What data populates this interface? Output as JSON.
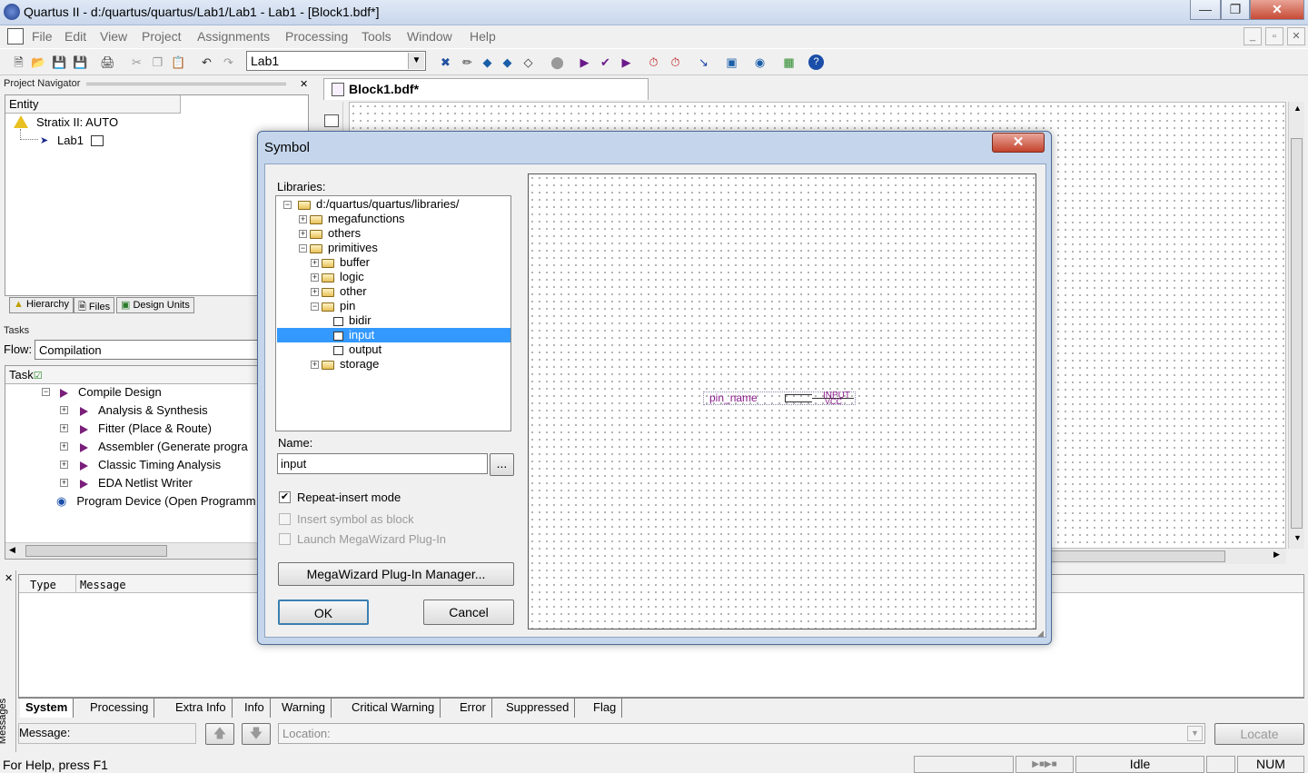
{
  "window": {
    "title": "Quartus II - d:/quartus/quartus/Lab1/Lab1 - Lab1 - [Block1.bdf*]"
  },
  "menu": [
    "File",
    "Edit",
    "View",
    "Project",
    "Assignments",
    "Processing",
    "Tools",
    "Window",
    "Help"
  ],
  "toolbar": {
    "project_value": "Lab1"
  },
  "project_navigator": {
    "title": "Project Navigator",
    "entity_header": "Entity",
    "device": "Stratix II: AUTO",
    "top_entity": "Lab1",
    "tabs": [
      "Hierarchy",
      "Files",
      "Design Units"
    ]
  },
  "tasks": {
    "title": "Tasks",
    "flow_label": "Flow:",
    "flow_value": "Compilation",
    "task_header": "Task",
    "items": [
      "Compile Design",
      "Analysis & Synthesis",
      "Fitter (Place & Route)",
      "Assembler (Generate progra",
      "Classic Timing Analysis",
      "EDA Netlist Writer",
      "Program Device (Open Programm"
    ]
  },
  "editor": {
    "tab": "Block1.bdf*"
  },
  "dialog": {
    "title": "Symbol",
    "libraries_label": "Libraries:",
    "tree": {
      "root": "d:/quartus/quartus/libraries/",
      "megafunctions": "megafunctions",
      "others": "others",
      "primitives": "primitives",
      "buffer": "buffer",
      "logic": "logic",
      "other": "other",
      "pin": "pin",
      "bidir": "bidir",
      "input": "input",
      "output": "output",
      "storage": "storage"
    },
    "name_label": "Name:",
    "name_value": "input",
    "browse": "...",
    "repeat_insert": "Repeat-insert mode",
    "insert_as_block": "Insert symbol as block",
    "launch_megawizard": "Launch MegaWizard Plug-In",
    "megawizard_btn": "MegaWizard Plug-In Manager...",
    "ok": "OK",
    "cancel": "Cancel",
    "preview": {
      "pin_name": "pin_name",
      "type": "INPUT",
      "vcc": "VCC"
    }
  },
  "messages": {
    "side_label": "Messages",
    "col_type": "Type",
    "col_message": "Message",
    "tabs": [
      "System",
      "Processing",
      "Extra Info",
      "Info",
      "Warning",
      "Critical Warning",
      "Error",
      "Suppressed",
      "Flag"
    ],
    "message_label": "Message:",
    "location_placeholder": "Location:",
    "locate_btn": "Locate"
  },
  "status": {
    "help": "For Help, press F1",
    "state": "Idle",
    "num": "NUM"
  }
}
